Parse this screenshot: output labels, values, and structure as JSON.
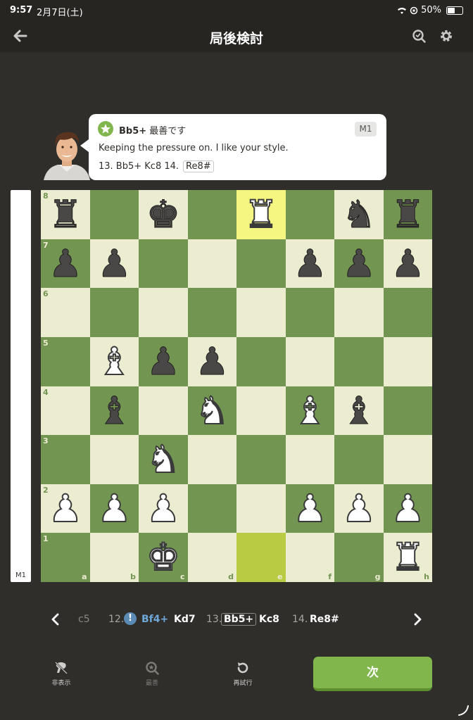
{
  "status": {
    "time": "9:57",
    "date": "2月7日(土)",
    "battery": "50%",
    "battery_level": 0.5
  },
  "header": {
    "title": "局後検討",
    "back_icon": "arrow-left-icon",
    "icons": [
      "analysis-search-icon",
      "gear-icon"
    ]
  },
  "coach": {
    "move": "Bb5+",
    "verdict": "最善です",
    "badge": "M1",
    "message": "Keeping the pressure on. I like your style.",
    "line_prefix": "13. Bb5+ Kc8 14.",
    "line_chip": "Re8#"
  },
  "eval_bar": {
    "label": "M1"
  },
  "board": {
    "ranks": [
      "8",
      "7",
      "6",
      "5",
      "4",
      "3",
      "2",
      "1"
    ],
    "files": [
      "a",
      "b",
      "c",
      "d",
      "e",
      "f",
      "g",
      "h"
    ],
    "highlight": [
      "e8",
      "e1"
    ],
    "pieces": [
      {
        "sq": "a8",
        "c": "b",
        "p": "r"
      },
      {
        "sq": "c8",
        "c": "b",
        "p": "k"
      },
      {
        "sq": "e8",
        "c": "w",
        "p": "r"
      },
      {
        "sq": "g8",
        "c": "b",
        "p": "n"
      },
      {
        "sq": "h8",
        "c": "b",
        "p": "r"
      },
      {
        "sq": "a7",
        "c": "b",
        "p": "p"
      },
      {
        "sq": "b7",
        "c": "b",
        "p": "p"
      },
      {
        "sq": "f7",
        "c": "b",
        "p": "p"
      },
      {
        "sq": "g7",
        "c": "b",
        "p": "p"
      },
      {
        "sq": "h7",
        "c": "b",
        "p": "p"
      },
      {
        "sq": "b5",
        "c": "w",
        "p": "b"
      },
      {
        "sq": "c5",
        "c": "b",
        "p": "p"
      },
      {
        "sq": "d5",
        "c": "b",
        "p": "p"
      },
      {
        "sq": "b4",
        "c": "b",
        "p": "b"
      },
      {
        "sq": "d4",
        "c": "w",
        "p": "n"
      },
      {
        "sq": "f4",
        "c": "w",
        "p": "b"
      },
      {
        "sq": "g4",
        "c": "b",
        "p": "b"
      },
      {
        "sq": "c3",
        "c": "w",
        "p": "n"
      },
      {
        "sq": "a2",
        "c": "w",
        "p": "p"
      },
      {
        "sq": "b2",
        "c": "w",
        "p": "p"
      },
      {
        "sq": "c2",
        "c": "w",
        "p": "p"
      },
      {
        "sq": "f2",
        "c": "w",
        "p": "p"
      },
      {
        "sq": "g2",
        "c": "w",
        "p": "p"
      },
      {
        "sq": "h2",
        "c": "w",
        "p": "p"
      },
      {
        "sq": "c1",
        "c": "w",
        "p": "k"
      },
      {
        "sq": "h1",
        "c": "w",
        "p": "r"
      }
    ]
  },
  "moves": {
    "prev": "c5",
    "num12": "12.",
    "m12w": "Bf4+",
    "m12b": "Kd7",
    "num13": "13.",
    "m13w": "Bb5+",
    "m13b": "Kc8",
    "num14": "14.",
    "m14w": "Re8#",
    "excl": "!"
  },
  "toolbar": {
    "hide": "非表示",
    "best": "最善",
    "retry": "再試行",
    "next": "次"
  },
  "colors": {
    "light": "#ebecd0",
    "dark": "#739552",
    "accent": "#81b64c"
  }
}
